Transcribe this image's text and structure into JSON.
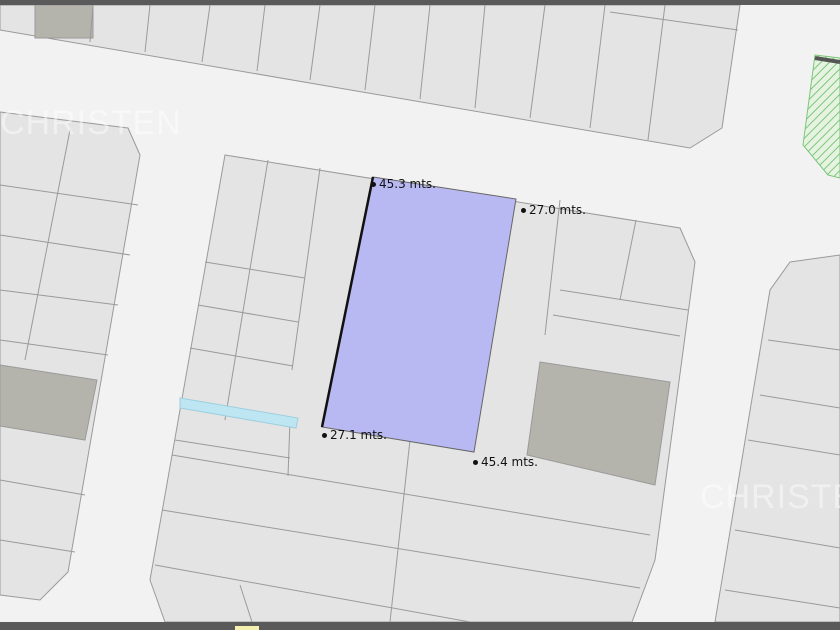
{
  "map": {
    "watermark": "CHRISTEN",
    "measurements": [
      {
        "id": "top",
        "label": "45.3 mts."
      },
      {
        "id": "right",
        "label": "27.0 mts."
      },
      {
        "id": "left",
        "label": "27.1 mts."
      },
      {
        "id": "bottom",
        "label": "45.4 mts."
      }
    ],
    "colors": {
      "road": "#f2f2f2",
      "parcel": "#e4e4e4",
      "selected_parcel": "#b8b8f2",
      "built": "#b5b4ac",
      "water": "#bde6f2",
      "green": "#8fd48f"
    }
  }
}
